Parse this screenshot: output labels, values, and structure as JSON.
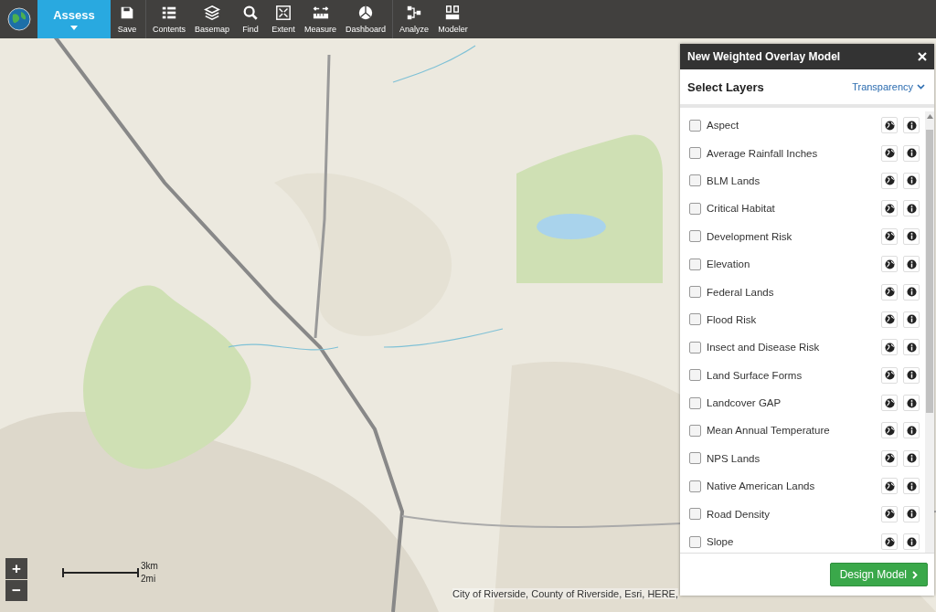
{
  "toolbar": {
    "mode_button": {
      "label": "Assess"
    },
    "tools": [
      {
        "label": "Save",
        "kind": "save"
      },
      {
        "label": "Contents",
        "kind": "contents"
      },
      {
        "label": "Basemap",
        "kind": "basemap"
      },
      {
        "label": "Find",
        "kind": "find"
      },
      {
        "label": "Extent",
        "kind": "extent"
      },
      {
        "label": "Measure",
        "kind": "measure"
      },
      {
        "label": "Dashboard",
        "kind": "dashboard"
      },
      {
        "label": "Analyze",
        "kind": "analyze"
      },
      {
        "label": "Modeler",
        "kind": "modeler"
      }
    ]
  },
  "map": {
    "zoom_buttons": [
      "+",
      "−"
    ],
    "scale_labels": [
      "3km",
      "2mi"
    ],
    "attribution": "City of Riverside, County of Riverside, Esri, HERE,"
  },
  "panel": {
    "title": "New Weighted Overlay Model",
    "section_title": "Select Layers",
    "transparency_link": "Transparency",
    "layers": [
      {
        "label": "Aspect",
        "checked": false
      },
      {
        "label": "Average Rainfall Inches",
        "checked": false
      },
      {
        "label": "BLM Lands",
        "checked": false
      },
      {
        "label": "Critical Habitat",
        "checked": false
      },
      {
        "label": "Development Risk",
        "checked": false
      },
      {
        "label": "Elevation",
        "checked": false
      },
      {
        "label": "Federal Lands",
        "checked": false
      },
      {
        "label": "Flood Risk",
        "checked": false
      },
      {
        "label": "Insect and Disease Risk",
        "checked": false
      },
      {
        "label": "Land Surface Forms",
        "checked": false
      },
      {
        "label": "Landcover GAP",
        "checked": false
      },
      {
        "label": "Mean Annual Temperature",
        "checked": false
      },
      {
        "label": "NPS Lands",
        "checked": false
      },
      {
        "label": "Native American Lands",
        "checked": false
      },
      {
        "label": "Road Density",
        "checked": false
      },
      {
        "label": "Slope",
        "checked": false
      }
    ],
    "design_button": "Design Model"
  }
}
